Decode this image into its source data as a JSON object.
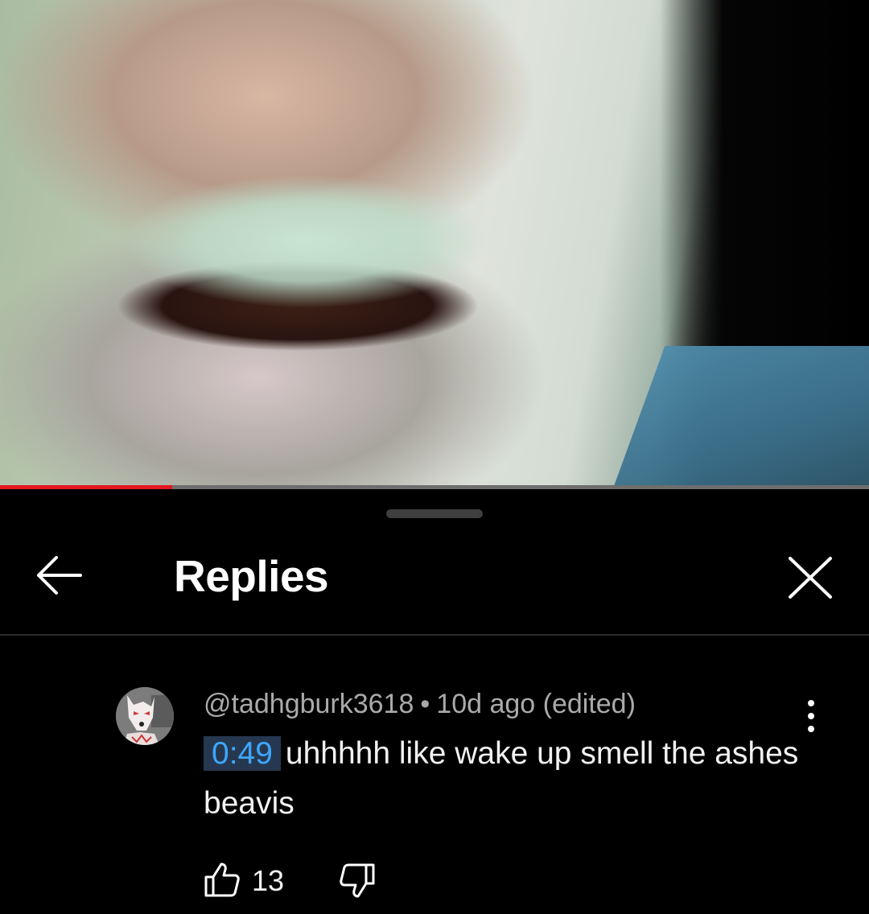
{
  "video": {
    "progress_fraction": 0.198,
    "progress_color": "#e5171f",
    "track_color": "#6e6e6e"
  },
  "header": {
    "title": "Replies",
    "back_icon": "arrow-left-icon",
    "close_icon": "close-icon"
  },
  "comment": {
    "author": "@tadhgburk3618",
    "separator": "•",
    "age": "10d ago (edited)",
    "timestamp_link": "0:49",
    "text": "uhhhhh like wake up smell the ashes beavis",
    "like_count": "13",
    "avatar_icon": "fox-mask-avatar",
    "more_icon": "more-vertical-icon",
    "like_icon": "thumbs-up-icon",
    "dislike_icon": "thumbs-down-icon"
  },
  "colors": {
    "background": "#000000",
    "timestamp_text": "#3ea6ff",
    "timestamp_bg": "#263850",
    "meta_text": "#aaaaaa"
  }
}
